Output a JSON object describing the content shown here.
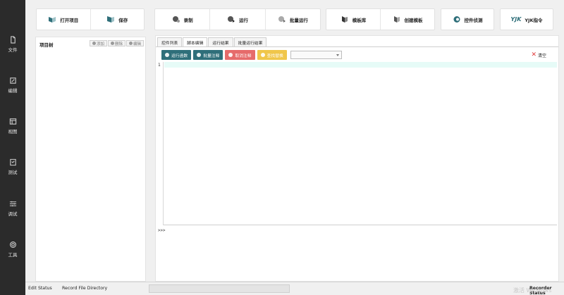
{
  "rail": {
    "items": [
      {
        "label": "文件"
      },
      {
        "label": "编辑"
      },
      {
        "label": "视图"
      },
      {
        "label": "测试"
      },
      {
        "label": "调试"
      },
      {
        "label": "工具"
      }
    ]
  },
  "toolbar": {
    "open_project": "打开项目",
    "save": "保存",
    "record": "录制",
    "run": "运行",
    "batch_run": "批量运行",
    "template_lib": "模板库",
    "create_template": "创建模板",
    "control_detect": "控件侦测",
    "yjk_cmd": "YJK指令"
  },
  "tree": {
    "title": "项目树",
    "add": "添加",
    "delete": "删除",
    "edit": "编辑"
  },
  "editor": {
    "tabs": [
      {
        "label": "控件列表",
        "active": false
      },
      {
        "label": "脚本编辑",
        "active": true
      },
      {
        "label": "运行结果",
        "active": false
      },
      {
        "label": "批量运行结果",
        "active": false
      }
    ],
    "run_func": "运行函数",
    "batch_comment": "批量注释",
    "cancel_comment": "取消注释",
    "find_replace": "查找替换",
    "select_value": "",
    "clear": "清空",
    "line_number": "1",
    "console_prompt": ">>>"
  },
  "status": {
    "edit": "Edit Status",
    "record_dir": "Record File Directory",
    "watermark": "激活 Windows",
    "recorder": "Recorder Status"
  },
  "colors": {
    "rail_bg": "#2b2b2b",
    "accent_teal": "#2f6f7a",
    "cancel_red": "#e66b6b",
    "search_yellow": "#f0c64a"
  }
}
